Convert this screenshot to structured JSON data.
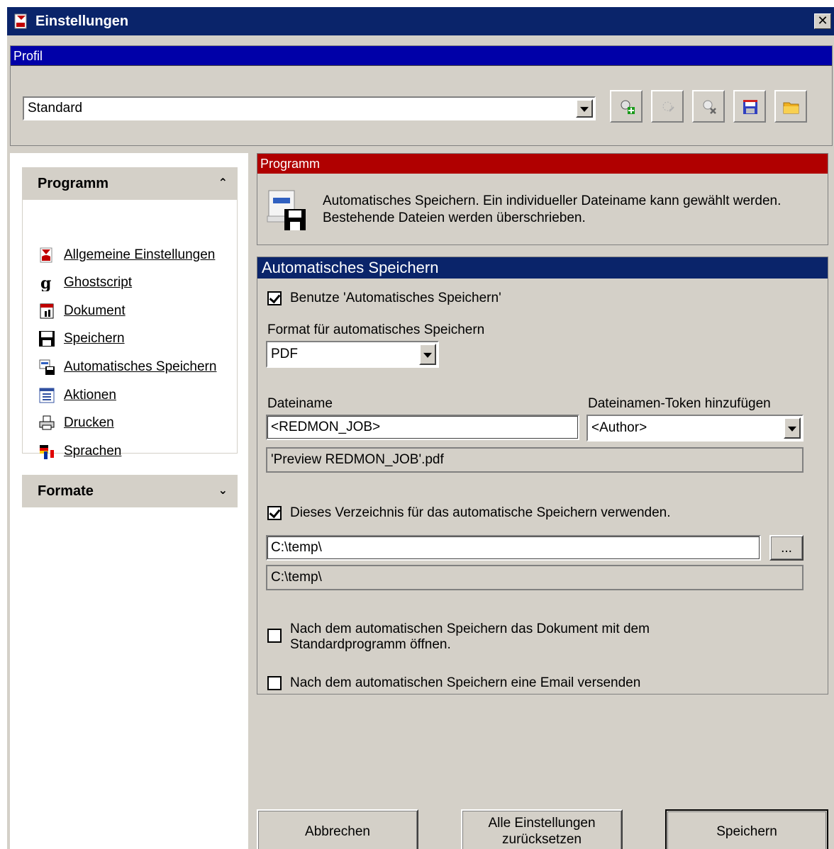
{
  "window": {
    "title": "Einstellungen",
    "close_label": "✕"
  },
  "profile": {
    "header": "Profil",
    "selected": "Standard",
    "tools": [
      {
        "icon": "add-profile-icon"
      },
      {
        "icon": "rename-profile-icon"
      },
      {
        "icon": "delete-profile-icon"
      },
      {
        "icon": "save-profile-icon"
      },
      {
        "icon": "open-folder-icon"
      }
    ]
  },
  "sidebar": {
    "groups": [
      {
        "title": "Programm",
        "items": [
          {
            "label": "Allgemeine Einstellungen",
            "icon": "pdf-settings-icon"
          },
          {
            "label": "Ghostscript",
            "icon": "ghostscript-icon"
          },
          {
            "label": "Dokument",
            "icon": "document-icon"
          },
          {
            "label": "Speichern",
            "icon": "floppy-disk-icon"
          },
          {
            "label": "Automatisches Speichern",
            "icon": "autosave-icon"
          },
          {
            "label": "Aktionen",
            "icon": "actions-icon"
          },
          {
            "label": "Drucken",
            "icon": "printer-icon"
          },
          {
            "label": "Sprachen",
            "icon": "flags-icon"
          }
        ]
      },
      {
        "title": "Formate"
      }
    ]
  },
  "program_section": {
    "header": "Programm",
    "description_line1": "Automatisches Speichern. Ein individueller Dateiname kann gewählt werden.",
    "description_line2": "Bestehende Dateien werden überschrieben."
  },
  "autosave": {
    "header": "Automatisches Speichern",
    "use_autosave_label": "Benutze 'Automatisches Speichern'",
    "use_autosave_checked": true,
    "format_label": "Format für automatisches Speichern",
    "format_value": "PDF",
    "filename_label": "Dateiname",
    "filename_value": "<REDMON_JOB>",
    "token_label": "Dateinamen-Token hinzufügen",
    "token_value": "<Author>",
    "filename_preview": "'Preview REDMON_JOB'.pdf",
    "use_dir_label": "Dieses Verzeichnis für das automatische Speichern verwenden.",
    "use_dir_checked": true,
    "dir_value": "C:\\temp\\",
    "browse_label": "...",
    "dir_preview": "C:\\temp\\",
    "open_after_label_line1": "Nach dem automatischen Speichern das Dokument mit dem",
    "open_after_label_line2": "Standardprogramm öffnen.",
    "open_after_checked": false,
    "email_label": "Nach dem automatischen Speichern eine Email versenden",
    "email_checked": false
  },
  "buttons": {
    "cancel": "Abbrechen",
    "reset_line1": "Alle Einstellungen",
    "reset_line2": "zurücksetzen",
    "save": "Speichern"
  },
  "colors": {
    "title_bar": "#0a246a",
    "profile_header": "#0000a8",
    "program_header": "#b00000",
    "face": "#d4d0c8"
  }
}
